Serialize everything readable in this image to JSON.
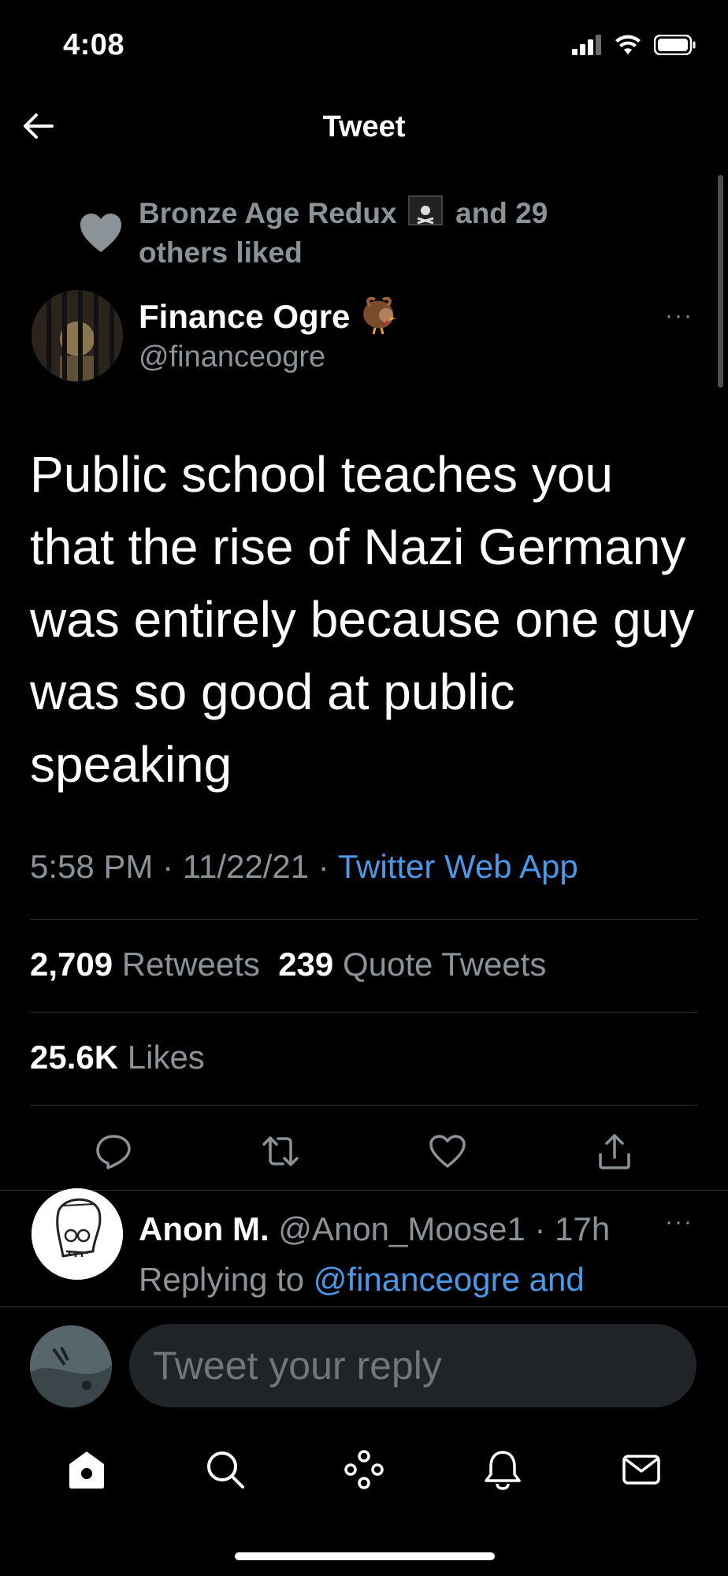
{
  "status_bar": {
    "time": "4:08"
  },
  "header": {
    "title": "Tweet"
  },
  "social_context": {
    "text_before": "Bronze Age Redux",
    "text_after": "and 29 others liked"
  },
  "tweet": {
    "author_name": "Finance Ogre",
    "author_handle": "@financeogre",
    "more_label": "···",
    "text": "Public school teaches you that the rise of Nazi Germany was entirely because one guy was so good at public speaking",
    "time": "5:58 PM",
    "date": "11/22/21",
    "separator": " · ",
    "source": "Twitter Web App"
  },
  "stats": {
    "retweets_count": "2,709",
    "retweets_label": "Retweets",
    "quotes_count": "239",
    "quotes_label": "Quote Tweets",
    "likes_count": "25.6K",
    "likes_label": "Likes"
  },
  "actions": [
    "reply-icon",
    "retweet-icon",
    "like-icon",
    "share-icon"
  ],
  "reply": {
    "name": "Anon M.",
    "handle": "@Anon_Moose1",
    "time_sep": " · ",
    "time": "17h",
    "more_label": "···",
    "replying_prefix": "Replying to",
    "replying_to": "@financeogre and"
  },
  "composer": {
    "placeholder": "Tweet your reply"
  },
  "tabbar": [
    "home-icon",
    "search-icon",
    "spaces-icon",
    "notifications-icon",
    "messages-icon"
  ],
  "colors": {
    "background": "#000000",
    "accent": "#4a99e9",
    "muted": "#8b9298",
    "text": "#e7e9ea"
  }
}
